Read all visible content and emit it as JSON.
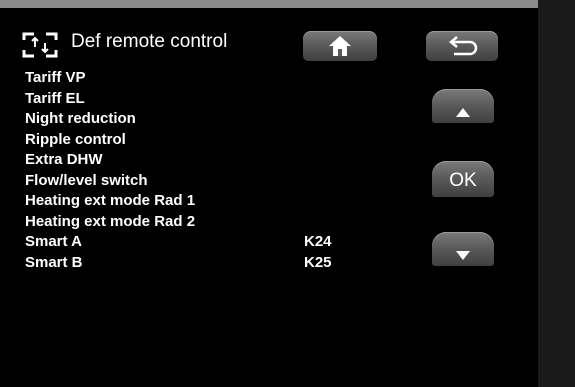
{
  "header": {
    "title": "Def remote control",
    "icon": "remote-control-bracket-icon"
  },
  "items": [
    {
      "label": "Tariff VP",
      "value": ""
    },
    {
      "label": "Tariff EL",
      "value": ""
    },
    {
      "label": "Night reduction",
      "value": ""
    },
    {
      "label": "Ripple control",
      "value": ""
    },
    {
      "label": "Extra DHW",
      "value": ""
    },
    {
      "label": "Flow/level switch",
      "value": ""
    },
    {
      "label": "Heating ext mode Rad 1",
      "value": ""
    },
    {
      "label": "Heating ext mode Rad 2",
      "value": ""
    },
    {
      "label": "Smart A",
      "value": "K24"
    },
    {
      "label": "Smart B",
      "value": "K25"
    }
  ],
  "buttons": {
    "home_icon": "home-icon",
    "back_icon": "return-arrow-icon",
    "up_icon": "arrow-up-icon",
    "ok_label": "OK",
    "down_icon": "arrow-down-icon"
  },
  "colors": {
    "background": "#000000",
    "text": "#ffffff",
    "button": "#5c5c5c"
  }
}
